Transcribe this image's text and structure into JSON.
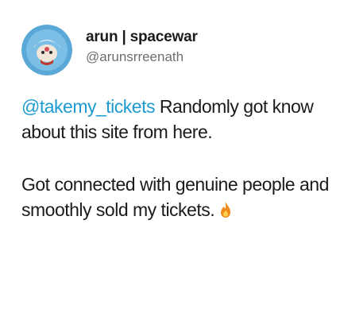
{
  "author": {
    "display_name": "arun | spacewar",
    "handle": "@arunsrreenath",
    "avatar_icon": "avatar-round-icon",
    "avatar_bg": "#5aa8d8"
  },
  "post": {
    "mention": "@takemy_tickets",
    "paragraph1_rest": " Randomly got know about this site from here.",
    "paragraph2": "Got connected with genuine people and smoothly sold my tickets.",
    "emoji_icon": "fire-icon"
  },
  "colors": {
    "text": "#1b1b1b",
    "handle": "#6e6e6e",
    "mention": "#1d9bd1",
    "fire": "#f08a1c"
  }
}
